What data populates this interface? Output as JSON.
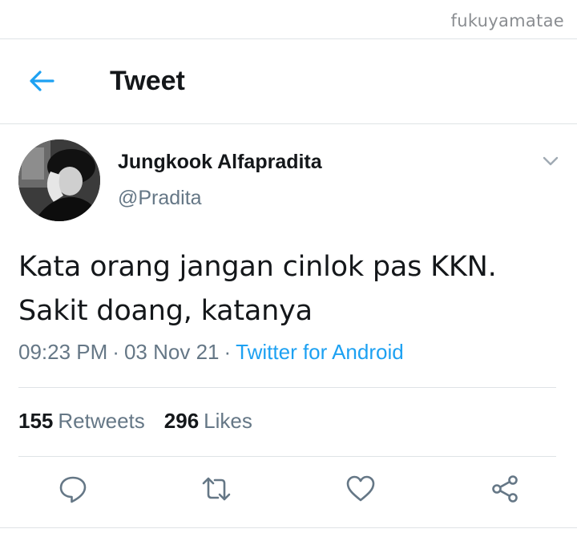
{
  "watermark": "fukuyamatae",
  "header": {
    "title": "Tweet",
    "back_icon": "arrow-left-icon"
  },
  "tweet": {
    "display_name": "Jungkook Alfapradita",
    "handle": "@Pradita",
    "text_line1": "Kata orang jangan cinlok pas KKN.",
    "text_line2": "Sakit doang, katanya",
    "time": "09:23 PM",
    "separator": "·",
    "date": "03 Nov 21",
    "source": "Twitter for Android"
  },
  "stats": {
    "retweets_count": "155",
    "retweets_label": "Retweets",
    "likes_count": "296",
    "likes_label": "Likes"
  },
  "actions": [
    "reply-icon",
    "retweet-icon",
    "like-icon",
    "share-icon"
  ],
  "colors": {
    "accent": "#1da1f2",
    "text_primary": "#14171a",
    "text_secondary": "#657786",
    "divider": "#dfe3e6"
  }
}
